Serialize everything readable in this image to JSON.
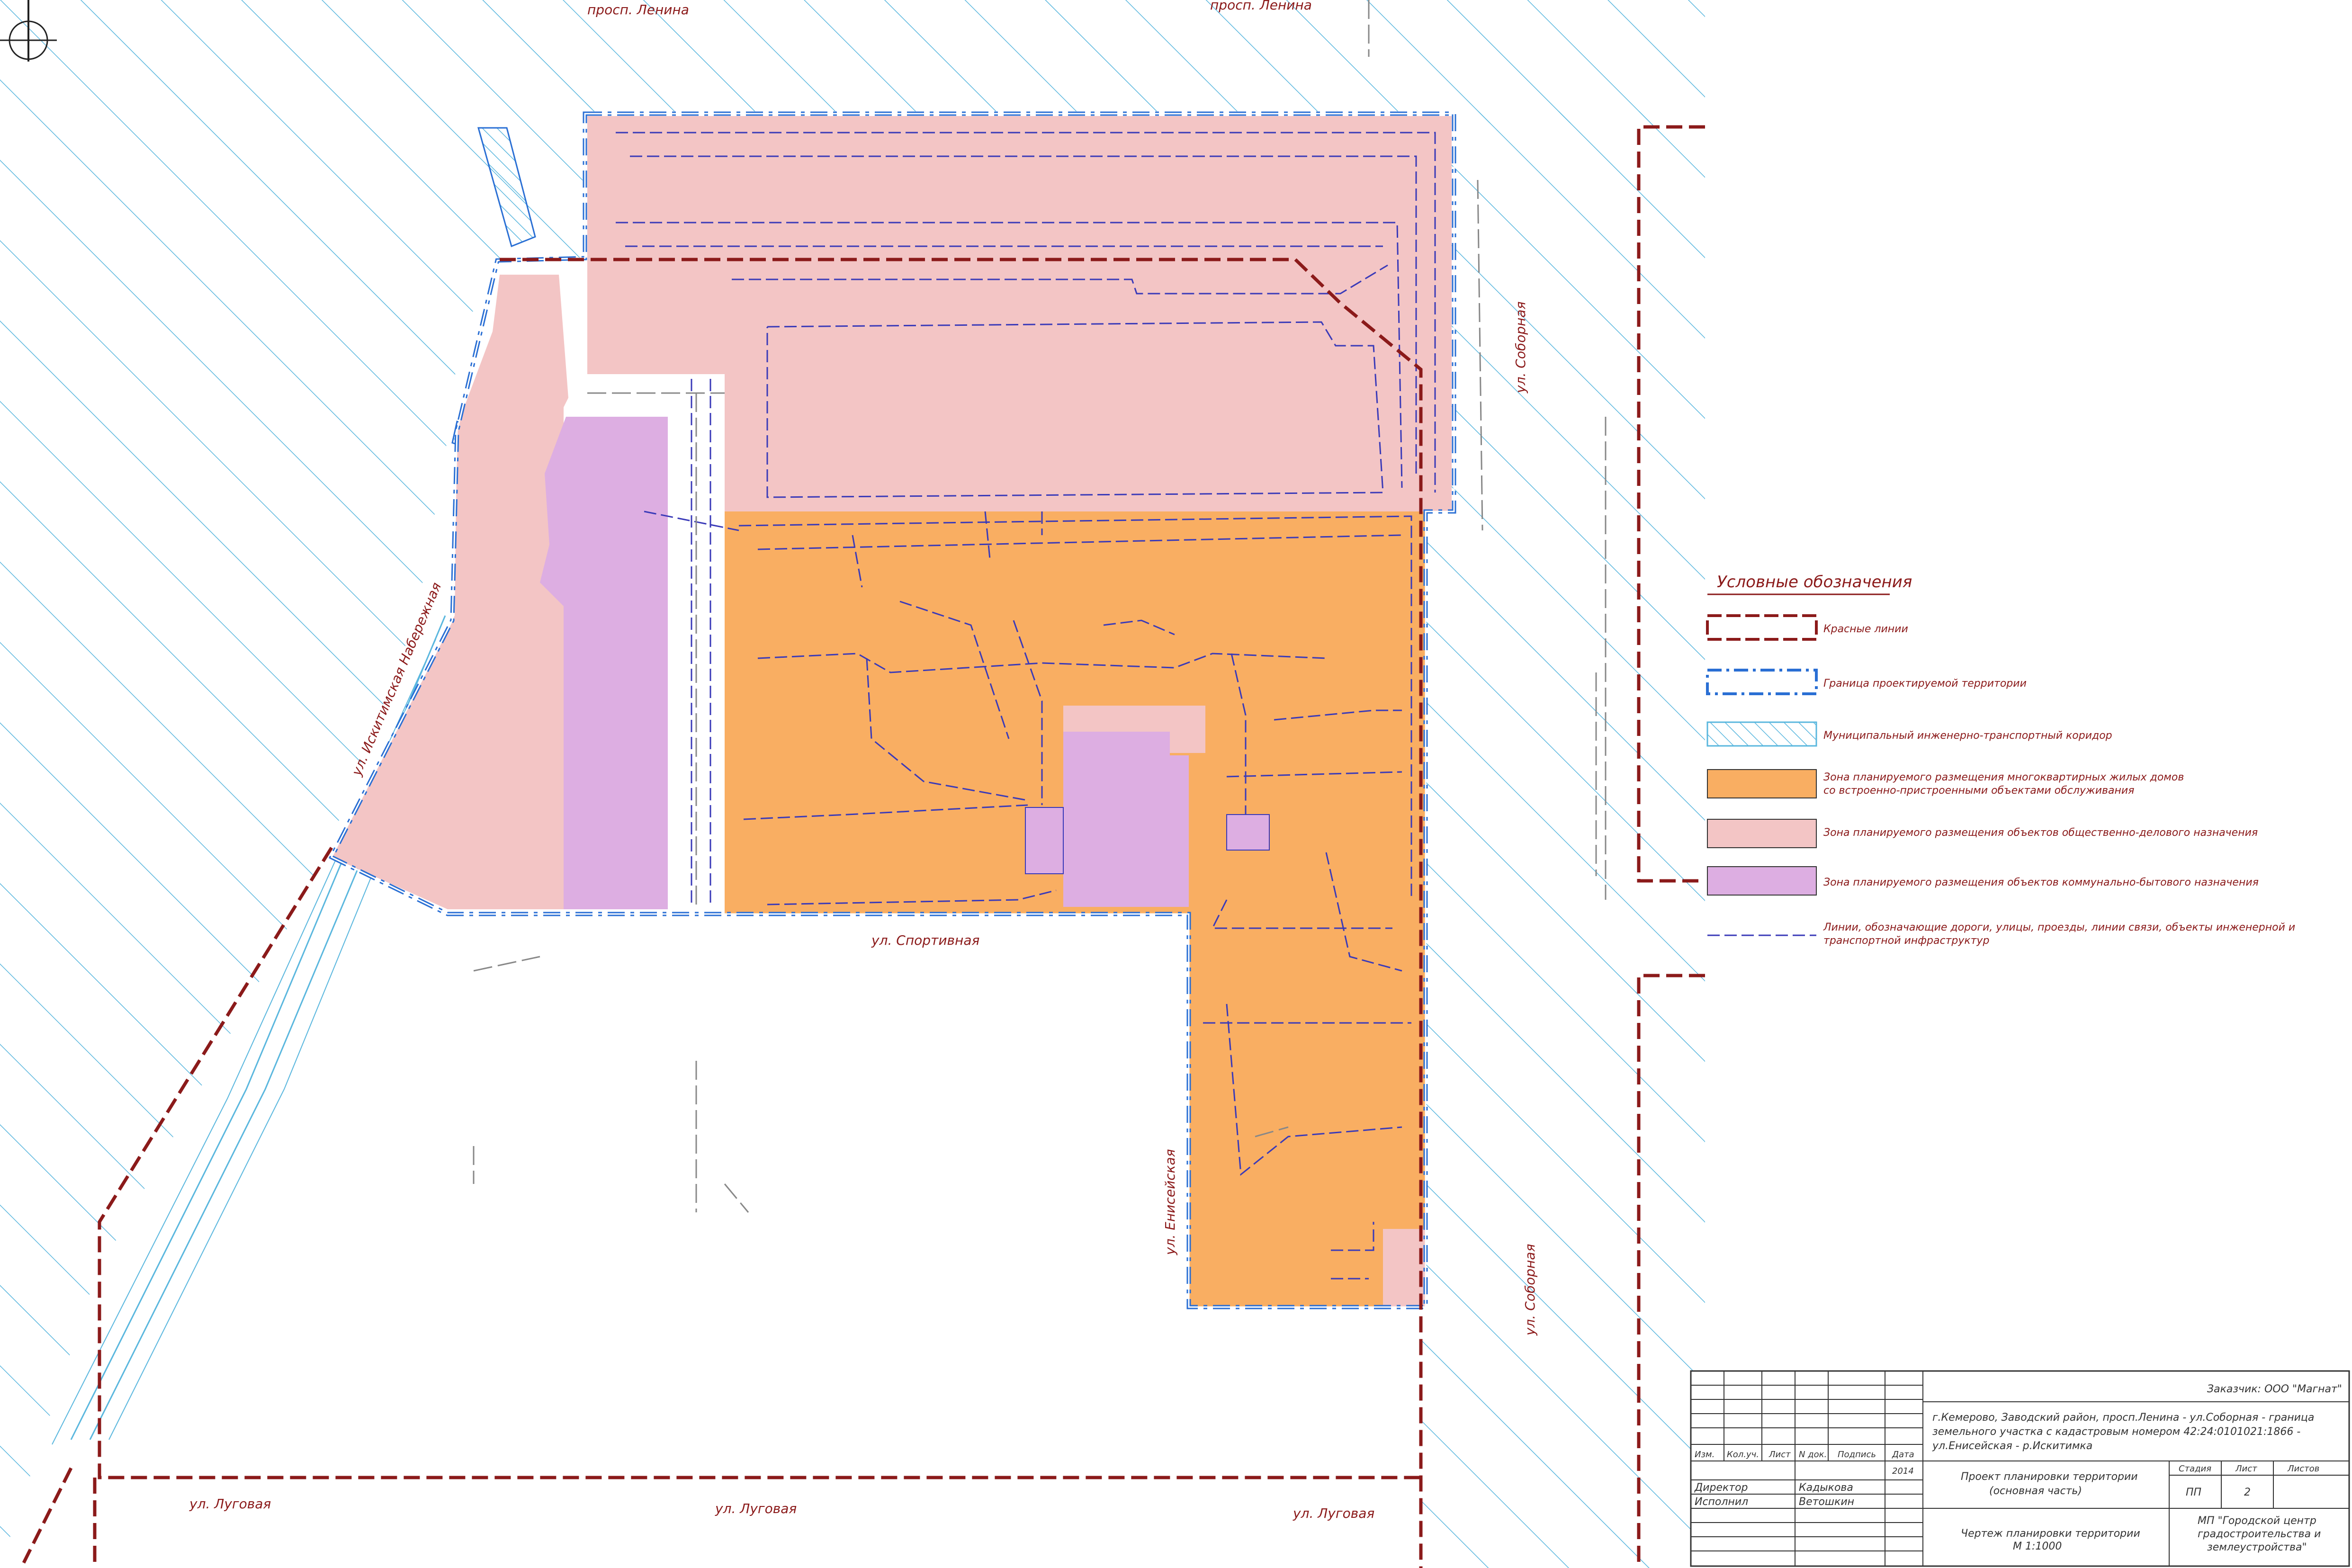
{
  "streets": {
    "lenina_left": "просп. Ленина",
    "lenina_right": "просп. Ленина",
    "sobornaya_top": "ул. Соборная",
    "sobornaya_bottom": "ул. Соборная",
    "iskitimskaya": "ул. Искитимская Набережная",
    "sportivnaya": "ул. Спортивная",
    "eniseyskaya": "ул. Енисейская",
    "lugovaya_left": "ул. Луговая",
    "lugovaya_mid": "ул. Луговая",
    "lugovaya_right": "ул. Луговая"
  },
  "legend": {
    "title": "Условные обозначения",
    "items": [
      {
        "label": "Красные линии",
        "kind": "red-dashed"
      },
      {
        "label": "Граница проектируемой территории",
        "kind": "blue-dashdot"
      },
      {
        "label": "Муниципальный инженерно-транспортный коридор",
        "kind": "hatch"
      },
      {
        "label": "Зона планируемого размещения многоквартирных жилых домов",
        "label2": "со встроенно-пристроенными объектами обслуживания",
        "kind": "orange"
      },
      {
        "label": "Зона планируемого размещения объектов общественно-делового назначения",
        "kind": "pink"
      },
      {
        "label": "Зона планируемого размещения объектов коммунально-бытового назначения",
        "kind": "violet"
      },
      {
        "label": "Линии, обозначающие дороги, улицы, проезды, линии связи, объекты инженерной и",
        "label2": "транспортной инфраструктур",
        "kind": "dash"
      }
    ]
  },
  "stamp": {
    "customer": "Заказчик: ООО \"Магнат\"",
    "address1": "г.Кемерово, Заводский район, просп.Ленина - ул.Соборная - граница",
    "address2": "земельного участка с кадастровым номером 42:24:0101021:1866 -",
    "address3": "ул.Енисейская - р.Искитимка",
    "col_izm": "Изм.",
    "col_koluch": "Кол.уч.",
    "col_list": "Лист",
    "col_ndok": "N док.",
    "col_podpis": "Подпись",
    "col_data": "Дата",
    "year": "2014",
    "role_director": "Директор",
    "name_director": "Кадыкова",
    "role_executor": "Исполнил",
    "name_executor": "Ветошкин",
    "project1": "Проект планировки территории",
    "project2": "(основная часть)",
    "stage_header": "Стадия",
    "sheet_header": "Лист",
    "sheets_header": "Листов",
    "stage_value": "ПП",
    "sheet_value": "2",
    "drawing1": "Чертеж планировки территории",
    "drawing2": "М 1:1000",
    "org1": "МП \"Городской центр",
    "org2": "градостроительства и",
    "org3": "землеустройства\""
  },
  "colors": {
    "orange": "#f9ae62",
    "pink": "#f3c5c5",
    "violet": "#ddaee2",
    "red_line": "#8b1a1a",
    "blue_boundary": "#2a6fd4",
    "hatch": "#5ab7de",
    "dash": "#3a3ab8"
  }
}
